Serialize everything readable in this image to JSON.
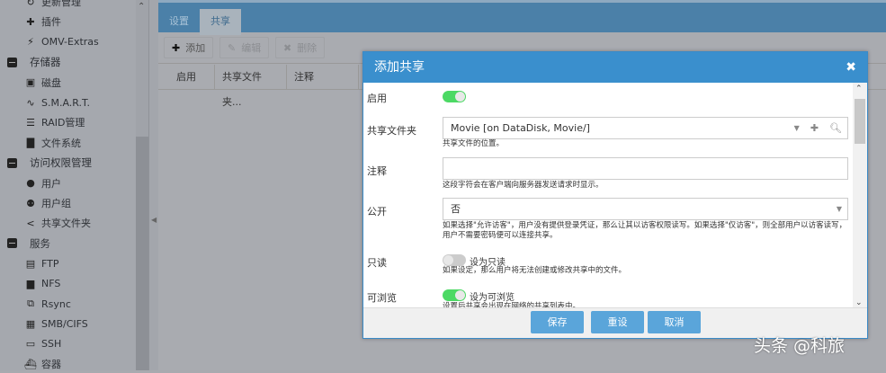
{
  "sidebar": {
    "items": [
      {
        "label": "更新管理",
        "icon": "refresh-icon",
        "type": "sub"
      },
      {
        "label": "插件",
        "icon": "puzzle-icon",
        "type": "sub"
      },
      {
        "label": "OMV-Extras",
        "icon": "plug-icon",
        "type": "sub"
      },
      {
        "label": "存储器",
        "icon": "collapse-icon",
        "type": "group"
      },
      {
        "label": "磁盘",
        "icon": "disk-icon",
        "type": "sub"
      },
      {
        "label": "S.M.A.R.T.",
        "icon": "pulse-icon",
        "type": "sub"
      },
      {
        "label": "RAID管理",
        "icon": "database-icon",
        "type": "sub"
      },
      {
        "label": "文件系统",
        "icon": "folder-icon",
        "type": "sub"
      },
      {
        "label": "访问权限管理",
        "icon": "collapse-icon",
        "type": "group"
      },
      {
        "label": "用户",
        "icon": "user-icon",
        "type": "sub"
      },
      {
        "label": "用户组",
        "icon": "users-icon",
        "type": "sub"
      },
      {
        "label": "共享文件夹",
        "icon": "share-icon",
        "type": "sub"
      },
      {
        "label": "服务",
        "icon": "collapse-icon",
        "type": "group"
      },
      {
        "label": "FTP",
        "icon": "server-icon",
        "type": "sub"
      },
      {
        "label": "NFS",
        "icon": "network-icon",
        "type": "sub"
      },
      {
        "label": "Rsync",
        "icon": "sync-icon",
        "type": "sub"
      },
      {
        "label": "SMB/CIFS",
        "icon": "windows-icon",
        "type": "sub"
      },
      {
        "label": "SSH",
        "icon": "terminal-icon",
        "type": "sub"
      },
      {
        "label": "容器",
        "icon": "docker-icon",
        "type": "sub"
      }
    ]
  },
  "main": {
    "tabs": [
      {
        "label": "设置"
      },
      {
        "label": "共享"
      }
    ],
    "toolbar": {
      "add": "添加",
      "edit": "编辑",
      "delete": "删除"
    },
    "columns": [
      "启用",
      "共享文件夹...",
      "注释"
    ]
  },
  "dialog": {
    "title": "添加共享",
    "enable_label": "启用",
    "enable_on": true,
    "folder_label": "共享文件夹",
    "folder_value": "Movie [on DataDisk, Movie/]",
    "folder_hint": "共享文件的位置。",
    "comment_label": "注释",
    "comment_value": "",
    "comment_hint": "这段字符会在客户端向服务器发送请求时显示。",
    "public_label": "公开",
    "public_value": "否",
    "public_hint": "如果选择\"允许访客\"，用户没有提供登录凭证，那么让其以访客权限读写。如果选择\"仅访客\"，则全部用户以访客读写，用户不需要密码便可以连接共享。",
    "readonly_label": "只读",
    "readonly_on": false,
    "readonly_toggle": "设为只读",
    "readonly_hint": "如果设定，那么用户将无法创建或修改共享中的文件。",
    "browse_label": "可浏览",
    "browse_on": true,
    "browse_toggle": "设为可浏览",
    "browse_hint": "设置后共享会出现在网络的共享列表中。",
    "buttons": {
      "save": "保存",
      "reset": "重设",
      "cancel": "取消"
    }
  },
  "watermark": "头条 @科旅"
}
